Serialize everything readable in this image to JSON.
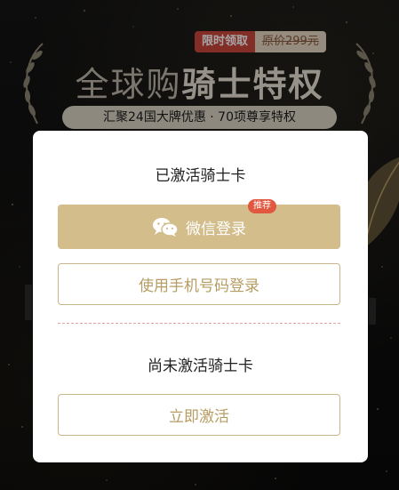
{
  "promo": {
    "limited_label": "限时领取",
    "original_price": "原价299元"
  },
  "hero": {
    "title_prefix": "全球购",
    "title_highlight": "骑士特权",
    "subtitle": "汇聚24国大牌优惠 · 70项尊享特权"
  },
  "modal": {
    "activated_heading": "已激活骑士卡",
    "wechat_login_label": "微信登录",
    "recommend_badge": "推荐",
    "phone_login_label": "使用手机号码登录",
    "unactivated_heading": "尚未激活骑士卡",
    "activate_now_label": "立即激活"
  },
  "colors": {
    "gold": "#d2bd8b",
    "gold_text": "#b59d63",
    "badge_red": "#e2573f",
    "promo_red": "#c9463d"
  },
  "icons": {
    "wechat": "wechat-icon",
    "laurel": "laurel-icon",
    "leaf": "leaf-decoration"
  }
}
